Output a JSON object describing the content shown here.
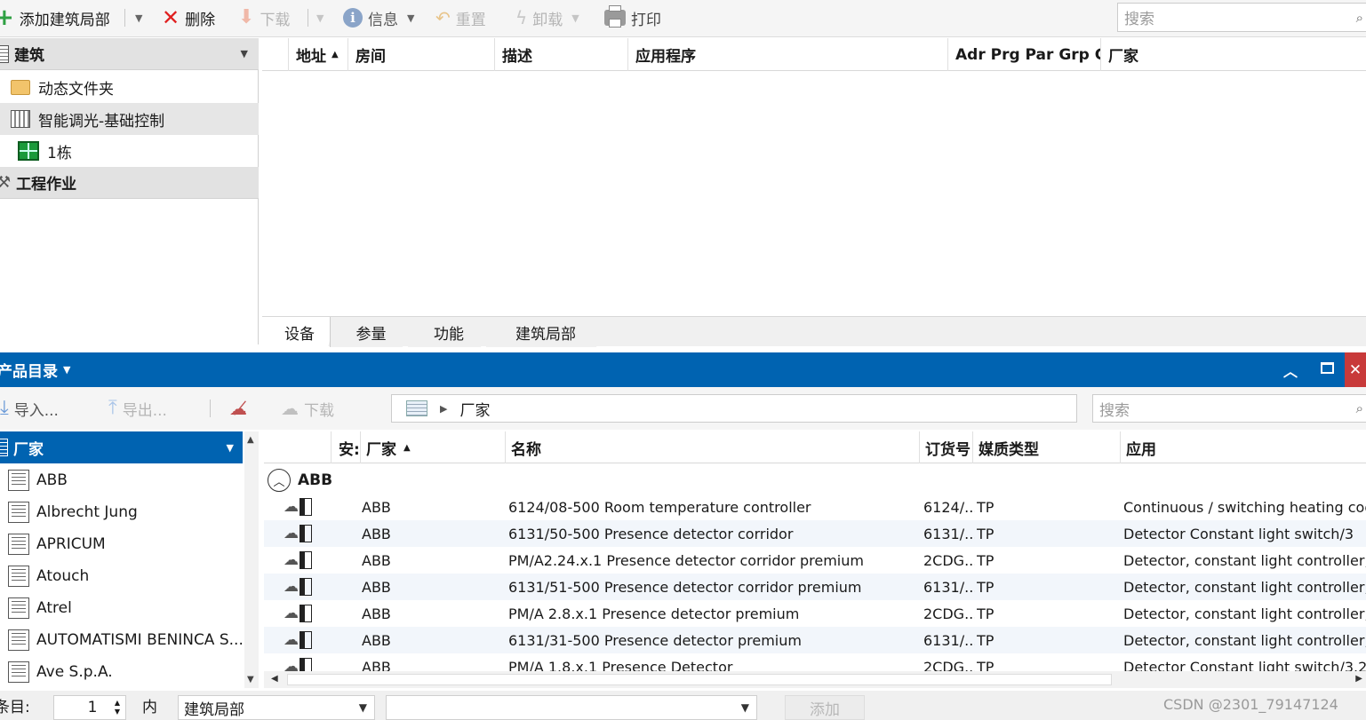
{
  "toolbar": {
    "add_label": "添加建筑局部",
    "delete_label": "删除",
    "download_label": "下载",
    "info_label": "信息",
    "reset_label": "重置",
    "unload_label": "卸载",
    "print_label": "打印",
    "search_placeholder": "搜索"
  },
  "left_panel": {
    "building_header": "建筑",
    "items": [
      {
        "label": "动态文件夹",
        "icon": "folder-icon"
      },
      {
        "label": "智能调光-基础控制",
        "icon": "building-icon"
      },
      {
        "label": "1栋",
        "icon": "floorplan-icon"
      }
    ],
    "project_header": "工程作业"
  },
  "grid": {
    "columns": [
      "地址",
      "房间",
      "描述",
      "应用程序",
      "Adr Prg Par Grp Cfg",
      "厂家"
    ],
    "sort_column": "地址"
  },
  "tabs": [
    "设备",
    "参量",
    "功能",
    "建筑局部"
  ],
  "catalog": {
    "title": "产品目录",
    "import_label": "导入...",
    "export_label": "导出...",
    "download_label": "下载",
    "breadcrumb": "厂家",
    "search_placeholder": "搜索",
    "vendor_header": "厂家",
    "vendors": [
      "ABB",
      "Albrecht Jung",
      "APRICUM",
      "Atouch",
      "Atrel",
      "AUTOMATISMI BENINCA S...",
      "Ave S.p.A."
    ],
    "columns": [
      "安:",
      "厂家",
      "名称",
      "订货号",
      "媒质类型",
      "应用"
    ],
    "group_label": "ABB",
    "rows": [
      {
        "vendor": "ABB",
        "name": "6124/08-500 Room temperature controller",
        "order": "6124/...",
        "medium": "TP",
        "app": "Continuous / switching heating coo"
      },
      {
        "vendor": "ABB",
        "name": "6131/50-500 Presence detector corridor",
        "order": "6131/...",
        "medium": "TP",
        "app": "Detector Constant light switch/3"
      },
      {
        "vendor": "ABB",
        "name": "PM/A2.24.x.1 Presence detector corridor premium",
        "order": "2CDG...",
        "medium": "TP",
        "app": "Detector, constant light controller, H"
      },
      {
        "vendor": "ABB",
        "name": "6131/51-500 Presence detector corridor premium",
        "order": "6131/...",
        "medium": "TP",
        "app": "Detector, constant light controller, H"
      },
      {
        "vendor": "ABB",
        "name": "PM/A 2.8.x.1 Presence detector premium",
        "order": "2CDG...",
        "medium": "TP",
        "app": "Detector, constant light controller, H"
      },
      {
        "vendor": "ABB",
        "name": "6131/31-500 Presence detector premium",
        "order": "6131/...",
        "medium": "TP",
        "app": "Detector, constant light controller, H"
      },
      {
        "vendor": "ABB",
        "name": "PM/A 1.8.x.1 Presence Detector",
        "order": "2CDG...",
        "medium": "TP",
        "app": "Detector Constant light switch/3.2"
      }
    ]
  },
  "statusbar": {
    "entries_label": "条目:",
    "quantity": "1",
    "in_label": "内",
    "location_value": "建筑局部",
    "add_label": "添加",
    "watermark": "CSDN @2301_79147124"
  },
  "colors": {
    "accent": "#0063b1",
    "delete": "#e02020",
    "add": "#2ea043"
  }
}
